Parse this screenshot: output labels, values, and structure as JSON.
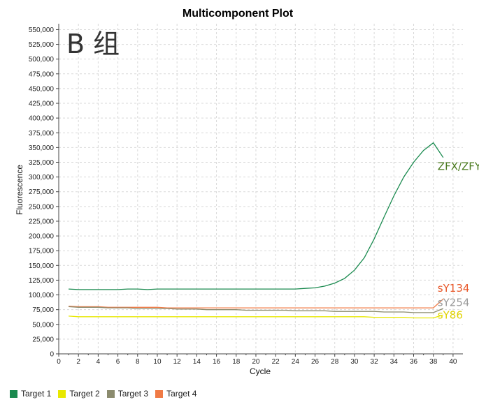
{
  "chart_data": {
    "type": "line",
    "title": "Multicomponent Plot",
    "panel_label": "B 组",
    "xlabel": "Cycle",
    "ylabel": "Fluorescence",
    "xlim": [
      0,
      41
    ],
    "ylim": [
      0,
      560000
    ],
    "x_ticks": [
      0,
      2,
      4,
      6,
      8,
      10,
      12,
      14,
      16,
      18,
      20,
      22,
      24,
      26,
      28,
      30,
      32,
      34,
      36,
      38,
      40
    ],
    "y_ticks": [
      0,
      25000,
      50000,
      75000,
      100000,
      125000,
      150000,
      175000,
      200000,
      225000,
      250000,
      275000,
      300000,
      325000,
      350000,
      375000,
      400000,
      425000,
      450000,
      475000,
      500000,
      525000,
      550000
    ],
    "y_tick_labels": [
      "0",
      "25,000",
      "50,000",
      "75,000",
      "100,000",
      "125,000",
      "150,000",
      "175,000",
      "200,000",
      "225,000",
      "250,000",
      "275,000",
      "300,000",
      "325,000",
      "350,000",
      "375,000",
      "400,000",
      "425,000",
      "450,000",
      "475,000",
      "500,000",
      "525,000",
      "550,000"
    ],
    "grid": true,
    "legend_position": "bottom-left",
    "series": [
      {
        "name": "Target 1",
        "color": "#1a8a4f",
        "x": [
          1,
          2,
          3,
          4,
          5,
          6,
          7,
          8,
          9,
          10,
          11,
          12,
          13,
          14,
          15,
          16,
          17,
          18,
          19,
          20,
          21,
          22,
          23,
          24,
          25,
          26,
          27,
          28,
          29,
          30,
          31,
          32,
          33,
          34,
          35,
          36,
          37,
          38,
          39
        ],
        "values": [
          110000,
          109000,
          109000,
          109000,
          109000,
          109000,
          110000,
          110000,
          109000,
          110000,
          110000,
          110000,
          110000,
          110000,
          110000,
          110000,
          110000,
          110000,
          110000,
          110000,
          110000,
          110000,
          110000,
          110000,
          111000,
          112000,
          115000,
          120000,
          128000,
          142000,
          163000,
          195000,
          232000,
          268000,
          300000,
          325000,
          345000,
          358000,
          333000
        ]
      },
      {
        "name": "Target 2",
        "color": "#e8e800",
        "x": [
          1,
          2,
          3,
          4,
          5,
          6,
          7,
          8,
          9,
          10,
          11,
          12,
          13,
          14,
          15,
          16,
          17,
          18,
          19,
          20,
          21,
          22,
          23,
          24,
          25,
          26,
          27,
          28,
          29,
          30,
          31,
          32,
          33,
          34,
          35,
          36,
          37,
          38,
          39
        ],
        "values": [
          64000,
          63000,
          63000,
          63000,
          63000,
          63000,
          63000,
          63000,
          63000,
          63000,
          63000,
          63000,
          63000,
          63000,
          63000,
          63000,
          63000,
          63000,
          63000,
          63000,
          63000,
          63000,
          63000,
          63000,
          63000,
          63000,
          63000,
          63000,
          63000,
          63000,
          63000,
          62000,
          62000,
          62000,
          62000,
          61000,
          61000,
          61000,
          66000
        ]
      },
      {
        "name": "Target 3",
        "color": "#8b8b6e",
        "x": [
          1,
          2,
          3,
          4,
          5,
          6,
          7,
          8,
          9,
          10,
          11,
          12,
          13,
          14,
          15,
          16,
          17,
          18,
          19,
          20,
          21,
          22,
          23,
          24,
          25,
          26,
          27,
          28,
          29,
          30,
          31,
          32,
          33,
          34,
          35,
          36,
          37,
          38,
          39
        ],
        "values": [
          80000,
          79000,
          79000,
          79000,
          78000,
          78000,
          78000,
          77000,
          77000,
          77000,
          77000,
          76000,
          76000,
          76000,
          75000,
          75000,
          75000,
          75000,
          74000,
          74000,
          74000,
          74000,
          74000,
          73000,
          73000,
          73000,
          73000,
          72000,
          72000,
          72000,
          72000,
          72000,
          71000,
          71000,
          71000,
          70000,
          70000,
          70000,
          77000
        ]
      },
      {
        "name": "Target 4",
        "color": "#f07a45",
        "x": [
          1,
          2,
          3,
          4,
          5,
          6,
          7,
          8,
          9,
          10,
          11,
          12,
          13,
          14,
          15,
          16,
          17,
          18,
          19,
          20,
          21,
          22,
          23,
          24,
          25,
          26,
          27,
          28,
          29,
          30,
          31,
          32,
          33,
          34,
          35,
          36,
          37,
          38,
          39
        ],
        "values": [
          81000,
          80000,
          80000,
          80000,
          79000,
          79000,
          79000,
          79000,
          79000,
          79000,
          78000,
          78000,
          78000,
          78000,
          78000,
          78000,
          78000,
          78000,
          78000,
          78000,
          78000,
          78000,
          78000,
          78000,
          78000,
          78000,
          78000,
          78000,
          78000,
          78000,
          78000,
          78000,
          78000,
          78000,
          78000,
          78000,
          78000,
          78000,
          93000
        ]
      }
    ],
    "annotations": [
      {
        "text": "ZFX/ZFY",
        "color": "#4a7a1e",
        "x": 39,
        "y": 318000
      },
      {
        "text": "sY134",
        "color": "#e8582a",
        "x": 39,
        "y": 111000
      },
      {
        "text": "sY254",
        "color": "#9a9a9a",
        "x": 39,
        "y": 87000
      },
      {
        "text": "sY86",
        "color": "#e0d200",
        "x": 39,
        "y": 66000
      }
    ]
  }
}
